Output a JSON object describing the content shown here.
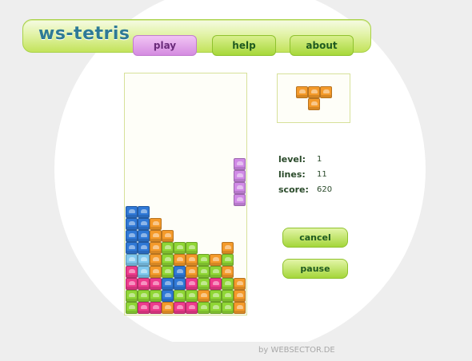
{
  "app": {
    "title": "ws-tetris",
    "footer": "by WEBSECTOR.DE"
  },
  "nav": {
    "tabs": [
      {
        "label": "play",
        "active": true
      },
      {
        "label": "help"
      },
      {
        "label": "about"
      }
    ]
  },
  "stats": {
    "level_label": "level:",
    "level_value": "1",
    "lines_label": "lines:",
    "lines_value": "11",
    "score_label": "score:",
    "score_value": "620"
  },
  "buttons": {
    "cancel": "cancel",
    "pause": "pause"
  },
  "colors": {
    "B": "#2f78d6",
    "C": "#7fc8ee",
    "O": "#f49a2a",
    "G": "#8fd635",
    "P": "#ee3b8c",
    "V": "#d08ae6"
  },
  "board": {
    "columns": 10,
    "rows": [
      "..........",
      "..........",
      "..........",
      "..........",
      "..........",
      "..........",
      "..........",
      "..........",
      "..........",
      ".........V",
      ".........V",
      ".........V",
      ".........V",
      "BB........",
      "BBO.......",
      "BBOO......",
      "BBOGGG..O.",
      "CCOGOOGOG.",
      "PCOGBOGGO.",
      "PPPBBPGPGO",
      "GGGBGGOGGO",
      "GPPOPPGGGO"
    ]
  },
  "next_piece": {
    "color": "O",
    "shape": [
      "OOO",
      ".O."
    ]
  }
}
